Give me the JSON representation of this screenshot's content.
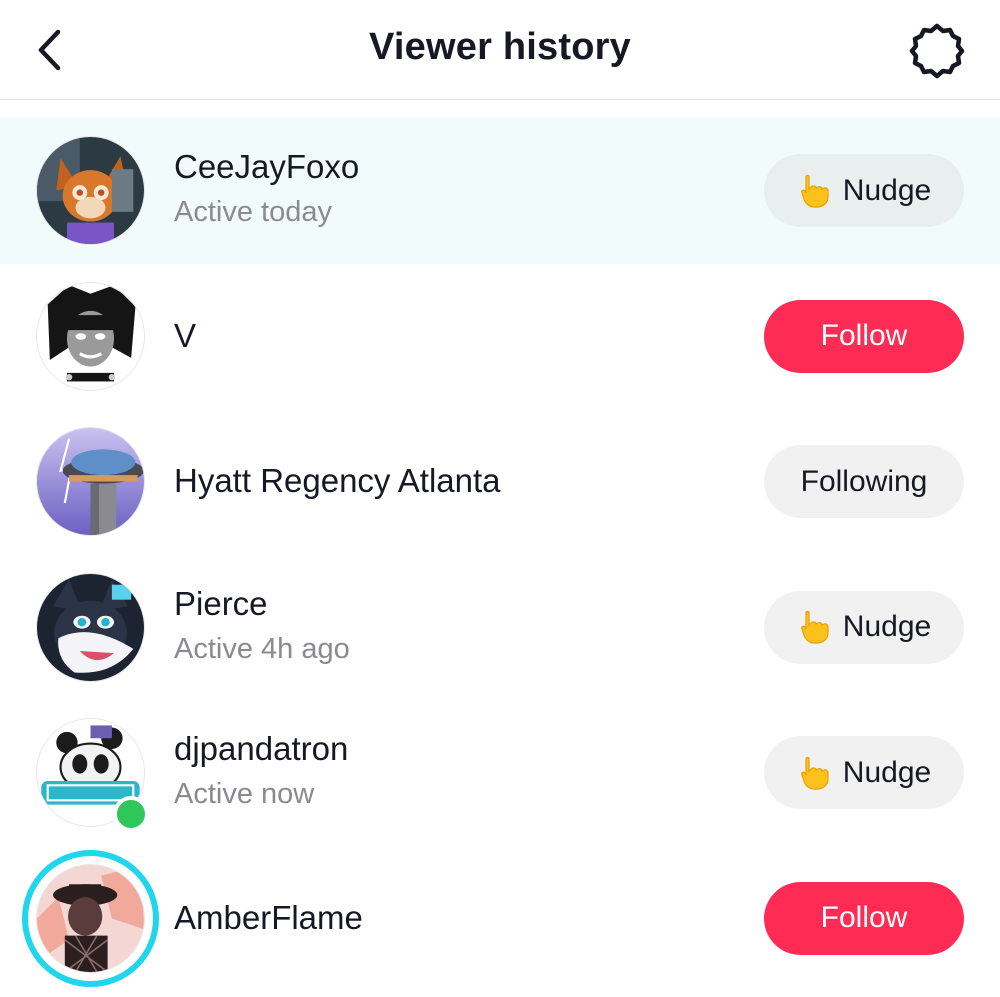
{
  "header": {
    "title": "Viewer history",
    "back_icon": "chevron-left-icon",
    "settings_icon": "gear-icon"
  },
  "colors": {
    "follow": "#fe2c55",
    "highlight_row": "#f2fbfc",
    "online": "#2fc65c",
    "story_ring": "#20d5ec",
    "secondary_text": "#8a8b91"
  },
  "viewers": [
    {
      "name": "CeeJayFoxo",
      "status": "Active today",
      "action": "Nudge",
      "action_type": "nudge",
      "highlighted": true
    },
    {
      "name": "V",
      "status": "",
      "action": "Follow",
      "action_type": "follow"
    },
    {
      "name": "Hyatt Regency Atlanta",
      "status": "",
      "action": "Following",
      "action_type": "following"
    },
    {
      "name": "Pierce",
      "status": "Active 4h ago",
      "action": "Nudge",
      "action_type": "nudge"
    },
    {
      "name": "djpandatron",
      "status": "Active now",
      "action": "Nudge",
      "action_type": "nudge",
      "online": true
    },
    {
      "name": "AmberFlame",
      "status": "",
      "action": "Follow",
      "action_type": "follow",
      "story_ring": true
    }
  ]
}
